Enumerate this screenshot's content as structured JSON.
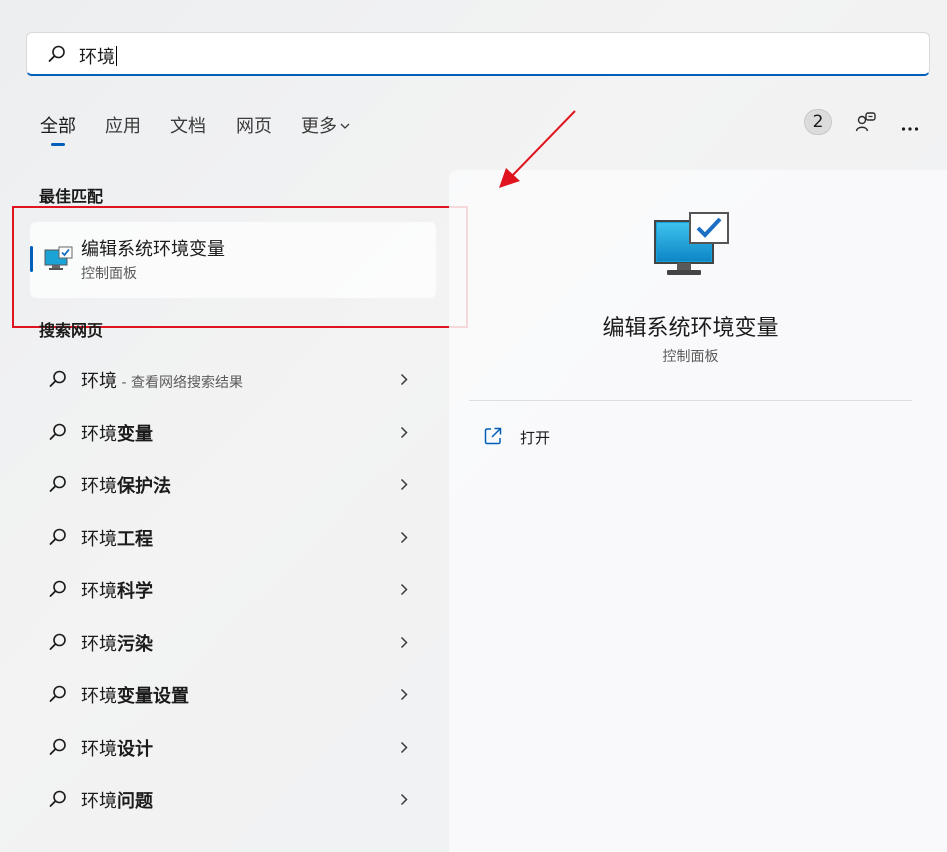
{
  "search": {
    "query": "环境"
  },
  "tabs": [
    {
      "label": "全部",
      "active": true
    },
    {
      "label": "应用"
    },
    {
      "label": "文档"
    },
    {
      "label": "网页"
    },
    {
      "label": "更多"
    }
  ],
  "header_right": {
    "badge_count": "2",
    "account_icon": "account-switch-icon",
    "more_icon": "ellipsis-icon"
  },
  "best_match": {
    "section_title": "最佳匹配",
    "title": "编辑系统环境变量",
    "subtitle": "控制面板",
    "icon": "monitor-check-icon"
  },
  "web_search": {
    "section_title": "搜索网页",
    "items": [
      {
        "prefix": "环境",
        "bold": "",
        "hint": " - 查看网络搜索结果"
      },
      {
        "prefix": "环境",
        "bold": "变量",
        "hint": ""
      },
      {
        "prefix": "环境",
        "bold": "保护法",
        "hint": ""
      },
      {
        "prefix": "环境",
        "bold": "工程",
        "hint": ""
      },
      {
        "prefix": "环境",
        "bold": "科学",
        "hint": ""
      },
      {
        "prefix": "环境",
        "bold": "污染",
        "hint": ""
      },
      {
        "prefix": "环境",
        "bold": "变量设置",
        "hint": ""
      },
      {
        "prefix": "环境",
        "bold": "设计",
        "hint": ""
      },
      {
        "prefix": "环境",
        "bold": "问题",
        "hint": ""
      }
    ]
  },
  "detail_panel": {
    "title": "编辑系统环境变量",
    "subtitle": "控制面板",
    "actions": [
      {
        "label": "打开",
        "icon": "open-external-icon"
      }
    ]
  },
  "colors": {
    "accent": "#005fb8",
    "annotation": "#e0141e"
  }
}
